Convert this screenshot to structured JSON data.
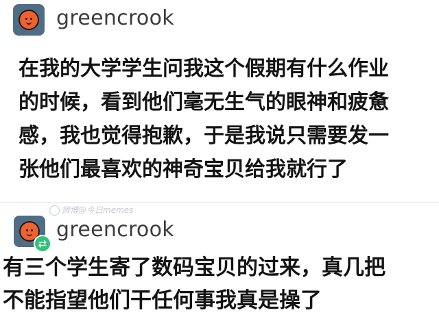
{
  "post_1": {
    "username": "greencrook",
    "text_lines": [
      "在我的大学学生问我这个假期有什么作业",
      "的时候，看到他们毫无生气的眼神和疲惫",
      "感，我也觉得抱歉，于是我说只需要发一",
      "张他们最喜欢的神奇宝贝给我就行了"
    ]
  },
  "watermark": {
    "text": "微博@今日memes"
  },
  "post_2": {
    "username": "greencrook",
    "badge_icon": "retweet-icon",
    "text_lines": [
      "有三个学生寄了数码宝贝的过来，真几把",
      "不能指望他们干任何事我真是操了"
    ]
  },
  "colors": {
    "avatar_bg": "#4f6e86",
    "avatar_face": "#f0612d",
    "badge": "#32c27a",
    "username": "#3c3c3c",
    "body_text": "#141414"
  }
}
